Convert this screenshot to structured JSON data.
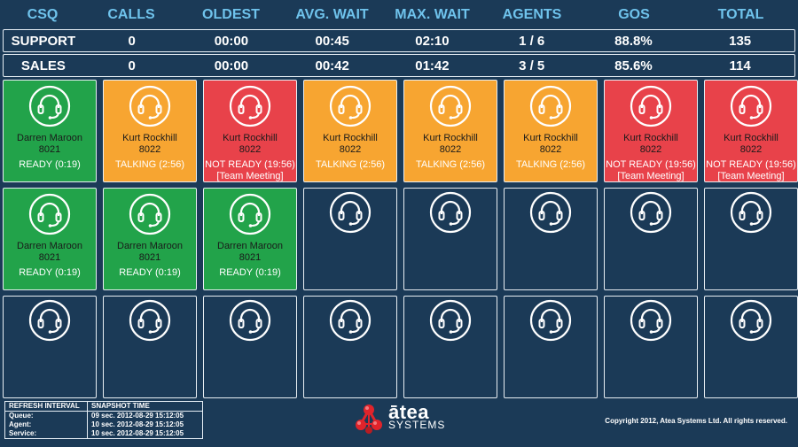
{
  "header": [
    "CSQ",
    "CALLS",
    "OLDEST",
    "AVG. WAIT",
    "MAX. WAIT",
    "AGENTS",
    "GOS",
    "TOTAL"
  ],
  "rows": [
    [
      "SUPPORT",
      "0",
      "00:00",
      "00:45",
      "02:10",
      "1 / 6",
      "88.8%",
      "135"
    ],
    [
      "SALES",
      "0",
      "00:00",
      "00:42",
      "01:42",
      "3 / 5",
      "85.6%",
      "114"
    ]
  ],
  "agents": [
    {
      "status": "ready",
      "name": "Darren Maroon",
      "ext": "8021",
      "state": "READY (0:19)",
      "note": ""
    },
    {
      "status": "talking",
      "name": "Kurt Rockhill",
      "ext": "8022",
      "state": "TALKING (2:56)",
      "note": ""
    },
    {
      "status": "notready",
      "name": "Kurt Rockhill",
      "ext": "8022",
      "state": "NOT READY (19:56)",
      "note": "[Team Meeting]"
    },
    {
      "status": "talking",
      "name": "Kurt Rockhill",
      "ext": "8022",
      "state": "TALKING (2:56)",
      "note": ""
    },
    {
      "status": "talking",
      "name": "Kurt Rockhill",
      "ext": "8022",
      "state": "TALKING (2:56)",
      "note": ""
    },
    {
      "status": "talking",
      "name": "Kurt Rockhill",
      "ext": "8022",
      "state": "TALKING (2:56)",
      "note": ""
    },
    {
      "status": "notready",
      "name": "Kurt Rockhill",
      "ext": "8022",
      "state": "NOT READY (19:56)",
      "note": "[Team Meeting]"
    },
    {
      "status": "notready",
      "name": "Kurt Rockhill",
      "ext": "8022",
      "state": "NOT READY (19:56)",
      "note": "[Team Meeting]"
    },
    {
      "status": "ready",
      "name": "Darren Maroon",
      "ext": "8021",
      "state": "READY (0:19)",
      "note": ""
    },
    {
      "status": "ready",
      "name": "Darren Maroon",
      "ext": "8021",
      "state": "READY (0:19)",
      "note": ""
    },
    {
      "status": "ready",
      "name": "Darren Maroon",
      "ext": "8021",
      "state": "READY (0:19)",
      "note": ""
    },
    {
      "status": "empty"
    },
    {
      "status": "empty"
    },
    {
      "status": "empty"
    },
    {
      "status": "empty"
    },
    {
      "status": "empty"
    },
    {
      "status": "empty"
    },
    {
      "status": "empty"
    },
    {
      "status": "empty"
    },
    {
      "status": "empty"
    },
    {
      "status": "empty"
    },
    {
      "status": "empty"
    },
    {
      "status": "empty"
    },
    {
      "status": "empty"
    }
  ],
  "refresh": {
    "header_left": "REFRESH INTERVAL",
    "header_right": "SNAPSHOT TIME",
    "rows": [
      {
        "label": "Queue:",
        "value": "09 sec. 2012-08-29 15:12:05"
      },
      {
        "label": "Agent:",
        "value": "10 sec. 2012-08-29 15:12:05"
      },
      {
        "label": "Service:",
        "value": "10 sec. 2012-08-29 15:12:05"
      }
    ]
  },
  "logo": {
    "name": "ātea",
    "sub": "SYSTEMS"
  },
  "copyright": "Copyright 2012, Atea Systems Ltd. All rights reserved.",
  "colors": {
    "background": "#1b3a57",
    "header_text": "#6fc3ec",
    "ready": "#22a34a",
    "talking": "#f7a531",
    "not_ready": "#e8424a",
    "logo_red": "#e0242b"
  },
  "icons": {
    "agent": "headset-icon",
    "logo": "atea-molecule-logo"
  }
}
